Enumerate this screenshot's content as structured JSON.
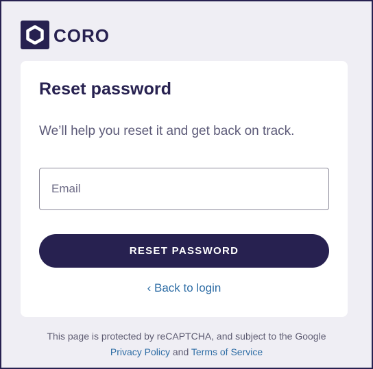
{
  "brand": {
    "name": "CORO",
    "color": "#272150"
  },
  "card": {
    "title": "Reset password",
    "subtitle": "We’ll help you reset it and get back on track.",
    "email_placeholder": "Email",
    "email_value": "",
    "reset_button_label": "RESET PASSWORD",
    "back_link_label": "‹ Back to login"
  },
  "footer": {
    "recaptcha_notice": "This page is protected by reCAPTCHA, and subject to the Google",
    "privacy_link_label": "Privacy Policy",
    "and_text": "and",
    "terms_link_label": "Terms of Service"
  },
  "colors": {
    "page_background": "#efeef4",
    "card_background": "#ffffff",
    "primary": "#272150",
    "link": "#2e6da5",
    "muted_text": "#5c5a78"
  }
}
